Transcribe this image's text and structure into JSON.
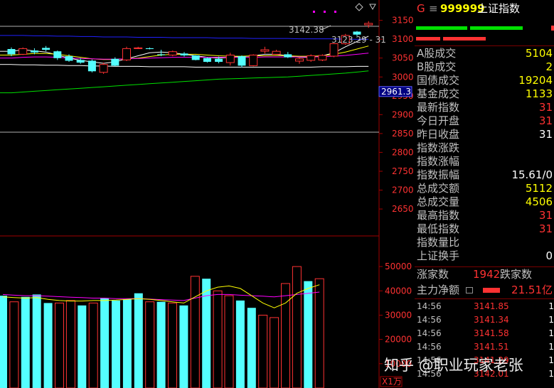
{
  "header": {
    "marker": "G",
    "code": "999999",
    "name": "上证指数",
    "menu_icon": "hamburger-icon"
  },
  "price_axis": {
    "ticks": [
      "3150",
      "3100",
      "3050",
      "3000",
      "2950",
      "2900",
      "2850",
      "2800",
      "2750",
      "2700",
      "2650"
    ],
    "current_label": "2961.3"
  },
  "volume_axis": {
    "ticks": [
      "50000",
      "40000",
      "30000",
      "20000",
      "10000"
    ],
    "unit": "X1万"
  },
  "annotations": {
    "high": "3142.38",
    "ma": "3123.29 - 31"
  },
  "stats": [
    {
      "label": "A股成交",
      "value": "5104",
      "color": "yellow"
    },
    {
      "label": "B股成交",
      "value": "2",
      "color": "yellow"
    },
    {
      "label": "国债成交",
      "value": "19204",
      "color": "yellow"
    },
    {
      "label": "基金成交",
      "value": "1133",
      "color": "yellow"
    },
    {
      "label": "最新指数",
      "value": "31",
      "color": "red"
    },
    {
      "label": "今日开盘",
      "value": "31",
      "color": "red"
    },
    {
      "label": "昨日收盘",
      "value": "31",
      "color": "white"
    },
    {
      "label": "指数涨跌",
      "value": "",
      "color": "red"
    },
    {
      "label": "指数涨幅",
      "value": "",
      "color": "red"
    },
    {
      "label": "指数振幅",
      "value": "15.61/0",
      "color": "white"
    },
    {
      "label": "总成交额",
      "value": "5112",
      "color": "yellow"
    },
    {
      "label": "总成交量",
      "value": "4506",
      "color": "yellow"
    },
    {
      "label": "最高指数",
      "value": "31",
      "color": "red"
    },
    {
      "label": "最低指数",
      "value": "31",
      "color": "red"
    },
    {
      "label": "指数量比",
      "value": "",
      "color": "white"
    },
    {
      "label": "上证换手",
      "value": "0",
      "color": "white"
    }
  ],
  "breadth": {
    "up_label": "涨家数",
    "up_value": "1942",
    "down_label": "跌家数"
  },
  "main_force": {
    "label": "主力净额",
    "value": "21.51亿"
  },
  "ticks": [
    {
      "time": "14:56",
      "price": "3141.85",
      "vol": "1"
    },
    {
      "time": "14:56",
      "price": "3141.34",
      "vol": "1"
    },
    {
      "time": "14:56",
      "price": "3141.58",
      "vol": "1"
    },
    {
      "time": "14:56",
      "price": "3141.51",
      "vol": "1"
    },
    {
      "time": "14:56",
      "price": "3141.29",
      "vol": "1"
    },
    {
      "time": "14:56",
      "price": "3142.01",
      "vol": "1"
    }
  ],
  "watermark": "知乎 @职业玩家老张",
  "colors": {
    "up": "#ff3232",
    "down": "#54ffff",
    "ma_white": "#ffffff",
    "ma_yellow": "#ffff00",
    "ma_magenta": "#ff00ff",
    "ma_green": "#00e000",
    "ma_blue": "#2020ff"
  },
  "chart_data": {
    "type": "candlestick",
    "price_ylim": [
      2620,
      3170
    ],
    "candles": [
      {
        "o": 3074,
        "h": 3078,
        "l": 3055,
        "c": 3060,
        "up": false
      },
      {
        "o": 3060,
        "h": 3078,
        "l": 3058,
        "c": 3075,
        "up": true
      },
      {
        "o": 3070,
        "h": 3076,
        "l": 3060,
        "c": 3065,
        "up": false
      },
      {
        "o": 3077,
        "h": 3082,
        "l": 3068,
        "c": 3072,
        "up": false
      },
      {
        "o": 3068,
        "h": 3070,
        "l": 3045,
        "c": 3050,
        "up": false
      },
      {
        "o": 3055,
        "h": 3060,
        "l": 3040,
        "c": 3043,
        "up": false
      },
      {
        "o": 3045,
        "h": 3050,
        "l": 3035,
        "c": 3038,
        "up": false
      },
      {
        "o": 3043,
        "h": 3046,
        "l": 3012,
        "c": 3015,
        "up": false
      },
      {
        "o": 3012,
        "h": 3038,
        "l": 3008,
        "c": 3033,
        "up": true
      },
      {
        "o": 3048,
        "h": 3052,
        "l": 3028,
        "c": 3030,
        "up": false
      },
      {
        "o": 3045,
        "h": 3080,
        "l": 3042,
        "c": 3075,
        "up": true
      },
      {
        "o": 3077,
        "h": 3080,
        "l": 3074,
        "c": 3076,
        "up": true
      },
      {
        "o": 3076,
        "h": 3078,
        "l": 3073,
        "c": 3074,
        "up": false
      },
      {
        "o": 3060,
        "h": 3072,
        "l": 3055,
        "c": 3058,
        "up": false
      },
      {
        "o": 3058,
        "h": 3070,
        "l": 3055,
        "c": 3067,
        "up": true
      },
      {
        "o": 3062,
        "h": 3066,
        "l": 3054,
        "c": 3057,
        "up": false
      },
      {
        "o": 3057,
        "h": 3058,
        "l": 3044,
        "c": 3045,
        "up": false
      },
      {
        "o": 3050,
        "h": 3052,
        "l": 3038,
        "c": 3040,
        "up": false
      },
      {
        "o": 3048,
        "h": 3054,
        "l": 3036,
        "c": 3040,
        "up": false
      },
      {
        "o": 3038,
        "h": 3064,
        "l": 3030,
        "c": 3058,
        "up": true
      },
      {
        "o": 3055,
        "h": 3057,
        "l": 3025,
        "c": 3030,
        "up": false
      },
      {
        "o": 3030,
        "h": 3060,
        "l": 3028,
        "c": 3058,
        "up": true
      },
      {
        "o": 3068,
        "h": 3080,
        "l": 3062,
        "c": 3072,
        "up": true
      },
      {
        "o": 3060,
        "h": 3072,
        "l": 3060,
        "c": 3068,
        "up": true
      },
      {
        "o": 3060,
        "h": 3066,
        "l": 3050,
        "c": 3052,
        "up": false
      },
      {
        "o": 3042,
        "h": 3052,
        "l": 3035,
        "c": 3048,
        "up": true
      },
      {
        "o": 3044,
        "h": 3060,
        "l": 3040,
        "c": 3056,
        "up": true
      },
      {
        "o": 3045,
        "h": 3060,
        "l": 3042,
        "c": 3057,
        "up": true
      },
      {
        "o": 3055,
        "h": 3090,
        "l": 3052,
        "c": 3088,
        "up": true
      },
      {
        "o": 3088,
        "h": 3114,
        "l": 3085,
        "c": 3110,
        "up": true
      },
      {
        "o": 3112,
        "h": 3122,
        "l": 3108,
        "c": 3120,
        "up": false
      },
      {
        "o": 3138,
        "h": 3148,
        "l": 3130,
        "c": 3142,
        "up": true
      }
    ],
    "volume_ylim": [
      0,
      55000
    ],
    "volumes": [
      {
        "v": 38000,
        "up": false
      },
      {
        "v": 35500,
        "up": true
      },
      {
        "v": 37500,
        "up": false
      },
      {
        "v": 38500,
        "up": false
      },
      {
        "v": 35000,
        "up": false
      },
      {
        "v": 35000,
        "up": true
      },
      {
        "v": 36000,
        "up": true
      },
      {
        "v": 34000,
        "up": false
      },
      {
        "v": 35000,
        "up": true
      },
      {
        "v": 37000,
        "up": false
      },
      {
        "v": 36000,
        "up": false
      },
      {
        "v": 36500,
        "up": false
      },
      {
        "v": 39000,
        "up": false
      },
      {
        "v": 35500,
        "up": true
      },
      {
        "v": 35500,
        "up": false
      },
      {
        "v": 35000,
        "up": true
      },
      {
        "v": 34000,
        "up": false
      },
      {
        "v": 46000,
        "up": true
      },
      {
        "v": 45000,
        "up": false
      },
      {
        "v": 40000,
        "up": true
      },
      {
        "v": 38000,
        "up": true
      },
      {
        "v": 36000,
        "up": false
      },
      {
        "v": 33000,
        "up": false
      },
      {
        "v": 30000,
        "up": true
      },
      {
        "v": 29000,
        "up": true
      },
      {
        "v": 43000,
        "up": true
      },
      {
        "v": 50000,
        "up": true
      },
      {
        "v": 44000,
        "up": false
      },
      {
        "v": 45000,
        "up": true
      }
    ],
    "ma_lines": [
      {
        "color": "ma_white",
        "values": [
          3068,
          3072,
          3069,
          3066,
          3058,
          3050,
          3044,
          3040,
          3036,
          3040,
          3048,
          3056,
          3064,
          3066,
          3064,
          3060,
          3056,
          3052,
          3050,
          3052,
          3054,
          3056,
          3060,
          3060,
          3056,
          3052,
          3052,
          3056,
          3064,
          3080,
          3094,
          3108
        ]
      },
      {
        "color": "ma_yellow",
        "values": [
          3058,
          3060,
          3062,
          3062,
          3060,
          3056,
          3052,
          3048,
          3046,
          3046,
          3048,
          3050,
          3054,
          3058,
          3060,
          3060,
          3060,
          3058,
          3056,
          3055,
          3055,
          3056,
          3056,
          3057,
          3056,
          3055,
          3055,
          3056,
          3060,
          3066,
          3074,
          3082
        ]
      },
      {
        "color": "ma_magenta",
        "values": [
          3050,
          3052,
          3053,
          3053,
          3052,
          3050,
          3049,
          3048,
          3047,
          3047,
          3048,
          3049,
          3050,
          3051,
          3052,
          3052,
          3052,
          3052,
          3052,
          3052,
          3052,
          3052,
          3053,
          3053,
          3053,
          3053,
          3053,
          3054,
          3055,
          3057,
          3060,
          3063
        ]
      },
      {
        "color": "ma_blue",
        "values": [
          3110,
          3110,
          3109,
          3109,
          3108,
          3108,
          3107,
          3107,
          3106,
          3106,
          3106,
          3105,
          3105,
          3105,
          3104,
          3104,
          3104,
          3104,
          3103,
          3103,
          3103,
          3102,
          3102,
          3102,
          3102,
          3101,
          3101,
          3101,
          3101,
          3100,
          3100,
          3100
        ]
      },
      {
        "color": "ma_green",
        "values": [
          2958,
          2960,
          2962,
          2964,
          2966,
          2968,
          2970,
          2972,
          2974,
          2976,
          2978,
          2980,
          2982,
          2984,
          2986,
          2988,
          2990,
          2992,
          2994,
          2995,
          2996,
          2997,
          2998,
          2999,
          3000,
          3002,
          3004,
          3006,
          3008,
          3010,
          3013,
          3016
        ]
      },
      {
        "color": "ma_white",
        "values": [
          3033,
          3032,
          3032,
          3031,
          3031,
          3030,
          3030,
          3029,
          3029,
          3028,
          3028,
          3028,
          3027,
          3027,
          3027,
          3027,
          3026,
          3026,
          3026,
          3026,
          3026,
          3026,
          3026,
          3026,
          3026,
          3026,
          3026,
          3027,
          3027,
          3027,
          3028,
          3028
        ]
      }
    ],
    "vol_ma_lines": [
      {
        "color": "ma_magenta",
        "values": [
          38500,
          38200,
          38000,
          38000,
          37800,
          37600,
          37400,
          37200,
          37000,
          37000,
          36800,
          36800,
          36800,
          36600,
          36400,
          36200,
          36000,
          37000,
          38000,
          38500,
          38500,
          38200,
          38000,
          37800,
          37500,
          38000,
          38500,
          39000,
          39500
        ]
      },
      {
        "color": "ma_yellow",
        "values": [
          37500,
          37200,
          37000,
          37200,
          36500,
          36000,
          35800,
          35800,
          36000,
          36000,
          36200,
          36500,
          36800,
          36500,
          36000,
          35500,
          35000,
          37500,
          40000,
          41500,
          42000,
          41000,
          38000,
          35000,
          33000,
          35000,
          39000,
          41000,
          42500
        ]
      }
    ]
  }
}
